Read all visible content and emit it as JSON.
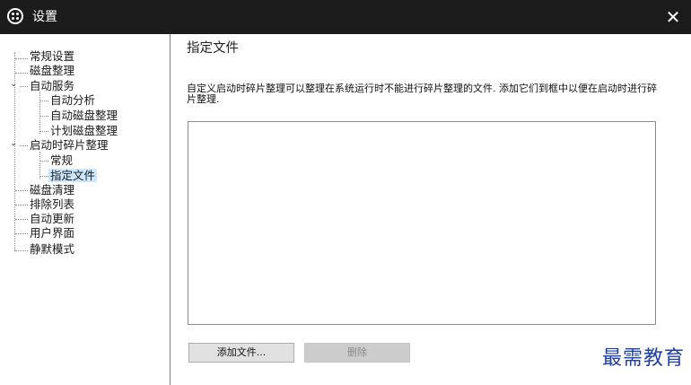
{
  "window": {
    "title": "设置",
    "close_glyph": "✕",
    "icon": "app-logo-icon"
  },
  "sidebar": {
    "items": [
      {
        "label": "常规设置",
        "level": 0
      },
      {
        "label": "磁盘整理",
        "level": 0
      },
      {
        "label": "自动服务",
        "level": 0,
        "expanded": true
      },
      {
        "label": "自动分析",
        "level": 1
      },
      {
        "label": "自动磁盘整理",
        "level": 1
      },
      {
        "label": "计划磁盘整理",
        "level": 1
      },
      {
        "label": "启动时碎片整理",
        "level": 0,
        "expanded": true
      },
      {
        "label": "常规",
        "level": 1
      },
      {
        "label": "指定文件",
        "level": 1,
        "selected": true
      },
      {
        "label": "磁盘清理",
        "level": 0
      },
      {
        "label": "排除列表",
        "level": 0
      },
      {
        "label": "自动更新",
        "level": 0
      },
      {
        "label": "用户界面",
        "level": 0
      },
      {
        "label": "静默模式",
        "level": 0
      }
    ],
    "expand_glyph": "⌄"
  },
  "main": {
    "heading": "指定文件",
    "description": "自定义启动时碎片整理可以整理在系统运行时不能进行碎片整理的文件. 添加它们到框中以便在启动时进行碎片整理.",
    "add_button": "添加文件...",
    "delete_button": "删除"
  },
  "watermark": "最需教育",
  "colors": {
    "titlebar": "#1c1c1c",
    "selection": "#cce8ff",
    "button": "#e1e1e1",
    "watermark": "#1b3fb0"
  }
}
